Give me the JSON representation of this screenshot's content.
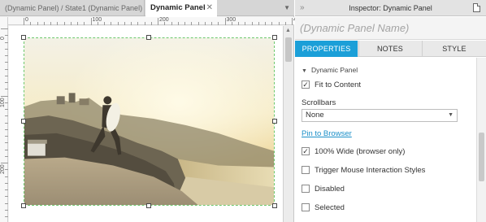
{
  "editor": {
    "tabs": [
      {
        "label": "(Dynamic Panel) / State1 (Dynamic Panel)",
        "close": "✕",
        "active": false
      },
      {
        "label": "Dynamic Panel",
        "close": "✕",
        "active": true
      }
    ],
    "tab_dropdown_icon": "chevron-down-icon",
    "ruler_top": [
      "0",
      "100",
      "200",
      "300",
      "400"
    ],
    "ruler_left": [
      "0",
      "100",
      "200"
    ]
  },
  "inspector": {
    "title": "Inspector: Dynamic Panel",
    "panel_name_placeholder": "(Dynamic Panel Name)",
    "tabs": [
      "PROPERTIES",
      "NOTES",
      "STYLE"
    ],
    "active_tab": "PROPERTIES",
    "section_title": "Dynamic Panel",
    "fit_to_content": {
      "label": "Fit to Content",
      "checked": true
    },
    "scrollbars_label": "Scrollbars",
    "scrollbars_value": "None",
    "pin_link": "Pin to Browser",
    "checkboxes": [
      {
        "label": "100% Wide (browser only)",
        "checked": true
      },
      {
        "label": "Trigger Mouse Interaction Styles",
        "checked": false
      },
      {
        "label": "Disabled",
        "checked": false
      },
      {
        "label": "Selected",
        "checked": false
      }
    ]
  },
  "colors": {
    "accent": "#1b9fd8",
    "link": "#1b8fc8",
    "selection": "#6cc86c"
  }
}
